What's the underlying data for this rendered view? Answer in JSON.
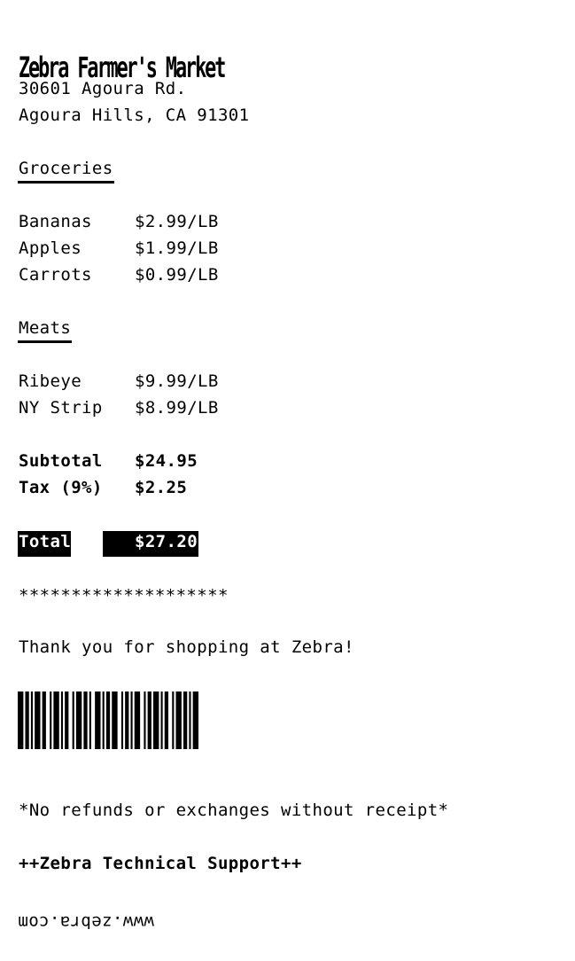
{
  "store": {
    "name": "Zebra Farmer's Market",
    "address_line1": "30601 Agoura Rd.",
    "address_line2": "Agoura Hills, CA 91301"
  },
  "sections": {
    "groceries": {
      "heading": "Groceries",
      "items": [
        {
          "name": "Bananas",
          "price": "$2.99/LB"
        },
        {
          "name": "Apples",
          "price": "$1.99/LB"
        },
        {
          "name": "Carrots",
          "price": "$0.99/LB"
        }
      ]
    },
    "meats": {
      "heading": "Meats",
      "items": [
        {
          "name": "Ribeye",
          "price": "$9.99/LB"
        },
        {
          "name": "NY Strip",
          "price": "$8.99/LB"
        }
      ]
    }
  },
  "totals": {
    "subtotal_label": "Subtotal",
    "subtotal_value": "$24.95",
    "tax_label": "Tax (9%)",
    "tax_value": "$2.25",
    "total_label": "Total",
    "total_value": "$27.20"
  },
  "footer": {
    "separator": "********************",
    "thank_you": "Thank you for shopping at Zebra!",
    "refund_policy": "*No refunds or exchanges without receipt*",
    "support": "++Zebra Technical Support++",
    "website": "www.zebra.com"
  },
  "barcode": {
    "color": "#000000",
    "bars": [
      3,
      1,
      2,
      1,
      1,
      1,
      3,
      1,
      2,
      2,
      1,
      1,
      3,
      1,
      1,
      1,
      2,
      2,
      1,
      1,
      3,
      1,
      2,
      1,
      1,
      2,
      3,
      1,
      1,
      1,
      2,
      1,
      3,
      2,
      1,
      1,
      2,
      1,
      1,
      1,
      3,
      2,
      1,
      1,
      2,
      1,
      3,
      1,
      1,
      1,
      2,
      2,
      1,
      1,
      3,
      1,
      2,
      1,
      1,
      1,
      3
    ]
  }
}
